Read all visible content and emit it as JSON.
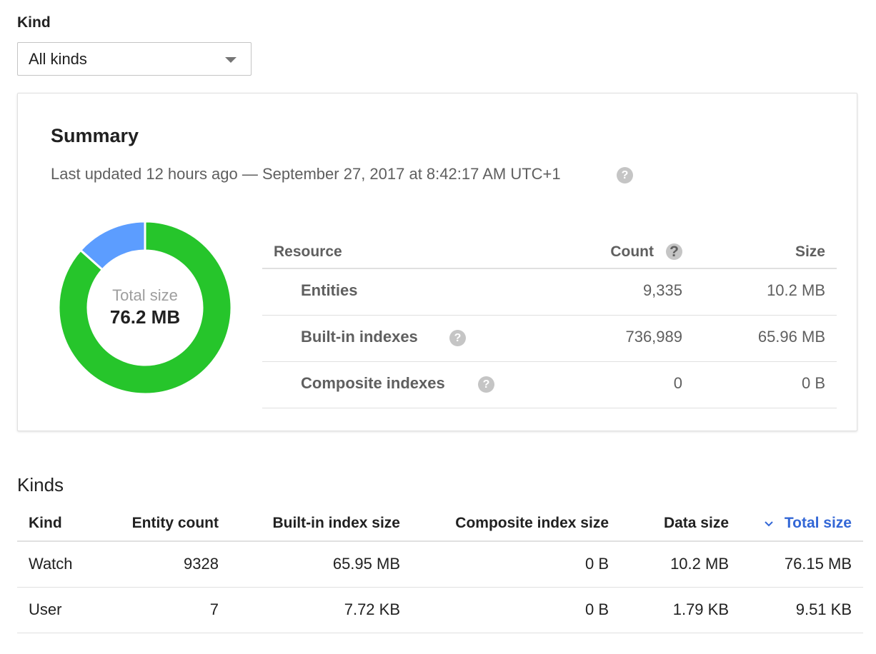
{
  "kind_filter": {
    "label": "Kind",
    "selected": "All kinds",
    "caret_icon": "chevron-down-icon"
  },
  "summary": {
    "title": "Summary",
    "last_updated": "Last updated 12 hours ago — September 27, 2017 at 8:42:17 AM UTC+1",
    "help_icon": "help-icon",
    "donut": {
      "label": "Total size",
      "value": "76.2 MB",
      "segments": [
        {
          "name": "Built-in indexes",
          "value": 65.96,
          "color": "#26c52b"
        },
        {
          "name": "Entities",
          "value": 10.2,
          "color": "#5c9dff"
        }
      ]
    },
    "table": {
      "headers": {
        "resource": "Resource",
        "count": "Count",
        "size": "Size"
      },
      "rows": [
        {
          "resource": "Entities",
          "count": "9,335",
          "size": "10.2 MB",
          "help": false
        },
        {
          "resource": "Built-in indexes",
          "count": "736,989",
          "size": "65.96 MB",
          "help": true
        },
        {
          "resource": "Composite indexes",
          "count": "0",
          "size": "0 B",
          "help": true
        }
      ]
    }
  },
  "kinds": {
    "title": "Kinds",
    "headers": {
      "kind": "Kind",
      "entity_count": "Entity count",
      "builtin_index_size": "Built-in index size",
      "composite_index_size": "Composite index size",
      "data_size": "Data size",
      "total_size": "Total size"
    },
    "sort_icon": "chevron-down-icon",
    "accent_color": "#3367d6",
    "rows": [
      {
        "kind": "Watch",
        "entity_count": "9328",
        "builtin_index_size": "65.95 MB",
        "composite_index_size": "0 B",
        "data_size": "10.2 MB",
        "total_size": "76.15 MB"
      },
      {
        "kind": "User",
        "entity_count": "7",
        "builtin_index_size": "7.72 KB",
        "composite_index_size": "0 B",
        "data_size": "1.79 KB",
        "total_size": "9.51 KB"
      }
    ]
  }
}
